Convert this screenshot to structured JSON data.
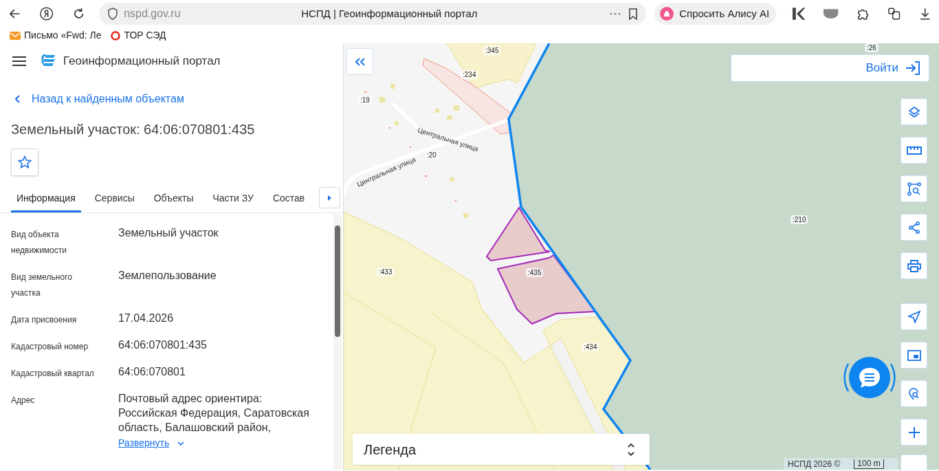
{
  "browser": {
    "address": "nspd.gov.ru",
    "page_title": "НСПД | Геоинформационный портал",
    "assistant_button": "Спросить Алису AI",
    "bookmarks": [
      {
        "label": "Письмо «Fwd: Ле",
        "kind": "mail"
      },
      {
        "label": "ТОР СЭД",
        "kind": "ring"
      }
    ]
  },
  "header": {
    "title": "Геоинформационный портал"
  },
  "back_link": "Назад к найденным объектам",
  "heading": "Земельный участок: 64:06:070801:435",
  "tabs": [
    {
      "label": "Информация",
      "selected": true
    },
    {
      "label": "Сервисы",
      "selected": false
    },
    {
      "label": "Объекты",
      "selected": false
    },
    {
      "label": "Части ЗУ",
      "selected": false
    },
    {
      "label": "Состав",
      "selected": false
    }
  ],
  "info_rows": [
    {
      "label": "Вид объекта недвижимости",
      "value": "Земельный участок"
    },
    {
      "label": "Вид земельного участка",
      "value": "Землепользование"
    },
    {
      "label": "Дата присвоения",
      "value": "17.04.2026"
    },
    {
      "label": "Кадастровый номер",
      "value": "64:06:070801:435"
    },
    {
      "label": "Кадастровый квартал",
      "value": "64:06:070801"
    },
    {
      "label": "Адрес",
      "value": "Почтовый адрес ориентира: Российская Федерация, Саратовская область, Балашовский район,"
    }
  ],
  "expand_link": "Развернуть",
  "map": {
    "login_button": "Войти",
    "legend": "Легенда",
    "attribution": "НСПД 2026 ©",
    "scale": "100 m",
    "parcel_labels": [
      ":345",
      ":234",
      ":19",
      ":20",
      ":433",
      ":435",
      ":434",
      ":210",
      ":26"
    ],
    "street_labels": [
      "Центральная улица",
      "Центральная улица"
    ]
  }
}
